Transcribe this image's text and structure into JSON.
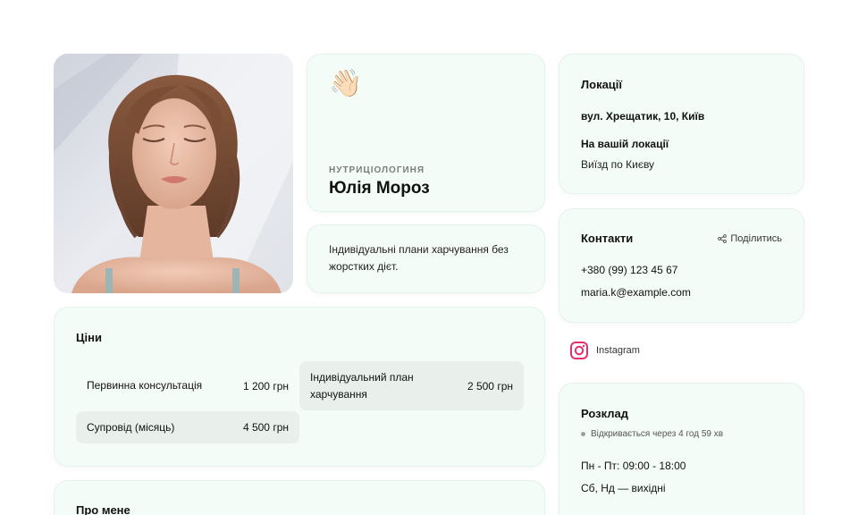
{
  "profile": {
    "wave_icon": "👋🏻",
    "role": "НУТРИЦІОЛОГИНЯ",
    "name": "Юлія Мороз",
    "bio": "Індивідуальні плани харчування без жорстких дієт."
  },
  "locations": {
    "title": "Локації",
    "address": "вул. Хрещатик, 10, Київ",
    "onsite_label": "На вашій локації",
    "onsite_value": "Виїзд по Києву"
  },
  "contacts": {
    "title": "Контакти",
    "share_label": "Поділитись",
    "phone": "+380 (99) 123 45 67",
    "email": "maria.k@example.com"
  },
  "social": {
    "instagram_label": "Instagram",
    "icon": "instagram-icon"
  },
  "schedule": {
    "title": "Розклад",
    "status": "Відкривається через 4 год 59 хв",
    "weekdays": "Пн - Пт: 09:00 - 18:00",
    "weekend": "Сб, Нд — вихідні"
  },
  "prices": {
    "title": "Ціни",
    "items": [
      {
        "label": "Первинна консультація",
        "value": "1 200 грн"
      },
      {
        "label": "Індивідуальний план харчування",
        "value": "2 500 грн"
      },
      {
        "label": "Супровід (місяць)",
        "value": "4 500 грн"
      }
    ]
  },
  "about": {
    "title": "Про мене"
  },
  "colors": {
    "card_bg": "#f4fcf7",
    "price_highlight": "#e9f0ec",
    "instagram_accent": "#e1306c"
  }
}
